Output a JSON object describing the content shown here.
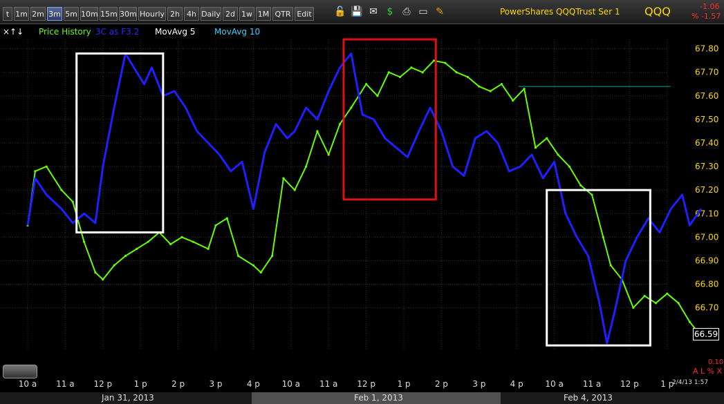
{
  "toolbar": {
    "buttons": [
      "t",
      "1m",
      "2m",
      "3m",
      "5m",
      "10m",
      "15m",
      "30m",
      "Hourly",
      "2h",
      "4h",
      "Daily",
      "2d",
      "1w",
      "1M",
      "QTR",
      "Edit"
    ],
    "active": "3m",
    "icons": [
      "lock-icon",
      "save-icon",
      "mail-icon",
      "dollar-icon",
      "print-icon",
      "screen-icon",
      "pencil-icon"
    ]
  },
  "header": {
    "title": "PowerShares QQQTrust Ser 1",
    "ticker": "QQQ",
    "change": "-1.06",
    "change_pct": "% -1.57"
  },
  "legend": {
    "controls": "×↑↓",
    "items": [
      "Price History",
      "3C as F3.2",
      "MovAvg 5",
      "MovAvg 10"
    ]
  },
  "footer": {
    "dates": [
      "Jan 31, 2013",
      "Feb 1, 2013",
      "Feb 4, 2013"
    ],
    "pct_value": "0.10",
    "pct_controls": "A L % X",
    "timestamp": "2/4/13 1:57"
  },
  "colors": {
    "price": "#66ff00",
    "indicator": "#1f1fff",
    "level_line": "#009090",
    "box_white": "#ffffff",
    "box_red": "#e01010",
    "y_axis_labels": "#ffd800",
    "grid": "#333333"
  },
  "chart_data": {
    "type": "line",
    "x_ticks": [
      "10 a",
      "11 a",
      "12 p",
      "1 p",
      "2 p",
      "3 p",
      "4 p",
      "10 a",
      "11 a",
      "12 p",
      "1 p",
      "2 p",
      "3 p",
      "4 p",
      "10 a",
      "11 a",
      "12 p",
      "1 p"
    ],
    "ylim": [
      66.52,
      67.84
    ],
    "y_ticks": [
      67.8,
      67.7,
      67.6,
      67.5,
      67.4,
      67.3,
      67.2,
      67.1,
      67.0,
      66.9,
      66.8,
      66.7
    ],
    "y_tick_labels": [
      "67.80",
      "67.70",
      "67.60",
      "67.50",
      "67.40",
      "67.30",
      "67.20",
      "67.10",
      "67.00",
      "66.90",
      "66.80",
      "66.70"
    ],
    "last_price": "66.59",
    "level_line": 67.64,
    "series": [
      {
        "name": "Price History",
        "x": [
          0,
          0.2,
          0.5,
          0.9,
          1.2,
          1.5,
          1.8,
          2.0,
          2.3,
          2.6,
          2.9,
          3.2,
          3.5,
          3.8,
          4.1,
          4.4,
          4.8,
          5.0,
          5.3,
          5.6,
          6.0,
          6.2,
          6.5,
          6.8,
          7.1,
          7.4,
          7.7,
          8.0,
          8.3,
          8.6,
          9.0,
          9.3,
          9.6,
          9.9,
          10.2,
          10.5,
          10.8,
          11.1,
          11.4,
          11.7,
          12.0,
          12.3,
          12.6,
          12.9,
          13.2,
          13.5,
          13.8,
          14.1,
          14.4,
          14.7,
          15.0,
          15.3,
          15.5,
          15.8,
          16.1,
          16.4,
          16.7,
          17.0,
          17.3,
          17.6,
          17.9
        ],
        "y": [
          67.05,
          67.28,
          67.3,
          67.2,
          67.15,
          66.98,
          66.85,
          66.82,
          66.88,
          66.92,
          66.95,
          66.98,
          67.02,
          66.97,
          67.0,
          66.98,
          66.95,
          67.05,
          67.08,
          66.92,
          66.88,
          66.85,
          66.92,
          67.25,
          67.2,
          67.3,
          67.45,
          67.35,
          67.48,
          67.55,
          67.65,
          67.6,
          67.7,
          67.68,
          67.72,
          67.7,
          67.75,
          67.74,
          67.7,
          67.68,
          67.64,
          67.62,
          67.65,
          67.58,
          67.63,
          67.38,
          67.42,
          67.35,
          67.3,
          67.22,
          67.18,
          67.0,
          66.88,
          66.82,
          66.7,
          66.75,
          66.72,
          66.76,
          66.72,
          66.64,
          66.58
        ]
      },
      {
        "name": "3C",
        "x": [
          0,
          0.2,
          0.5,
          0.9,
          1.2,
          1.5,
          1.8,
          2.0,
          2.3,
          2.6,
          2.9,
          3.1,
          3.3,
          3.6,
          3.9,
          4.2,
          4.5,
          4.8,
          5.1,
          5.4,
          5.7,
          6.0,
          6.3,
          6.6,
          6.9,
          7.1,
          7.4,
          7.7,
          8.0,
          8.3,
          8.6,
          8.9,
          9.2,
          9.5,
          9.8,
          10.1,
          10.4,
          10.7,
          11.0,
          11.3,
          11.6,
          11.9,
          12.2,
          12.5,
          12.8,
          13.1,
          13.4,
          13.7,
          14.0,
          14.3,
          14.6,
          14.9,
          15.2,
          15.4,
          15.6,
          15.9,
          16.2,
          16.5,
          16.8,
          17.1,
          17.4,
          17.6,
          17.9
        ],
        "y": [
          67.05,
          67.25,
          67.18,
          67.12,
          67.06,
          67.1,
          67.06,
          67.3,
          67.55,
          67.78,
          67.7,
          67.65,
          67.72,
          67.6,
          67.62,
          67.55,
          67.45,
          67.4,
          67.35,
          67.28,
          67.32,
          67.12,
          67.36,
          67.48,
          67.42,
          67.45,
          67.55,
          67.5,
          67.62,
          67.72,
          67.78,
          67.52,
          67.5,
          67.42,
          67.38,
          67.34,
          67.45,
          67.55,
          67.45,
          67.3,
          67.26,
          67.42,
          67.45,
          67.4,
          67.28,
          67.3,
          67.35,
          67.25,
          67.32,
          67.1,
          67.0,
          66.92,
          66.72,
          66.55,
          66.68,
          66.9,
          67.0,
          67.08,
          67.02,
          67.12,
          67.18,
          67.05,
          67.12
        ]
      }
    ],
    "boxes": [
      {
        "color": "white",
        "x": [
          1.3,
          3.6
        ],
        "y": [
          67.02,
          67.78
        ]
      },
      {
        "color": "red",
        "x": [
          8.4,
          10.85
        ],
        "y": [
          67.16,
          67.84
        ]
      },
      {
        "color": "white",
        "x": [
          13.8,
          16.55
        ],
        "y": [
          66.54,
          67.2
        ]
      }
    ]
  }
}
